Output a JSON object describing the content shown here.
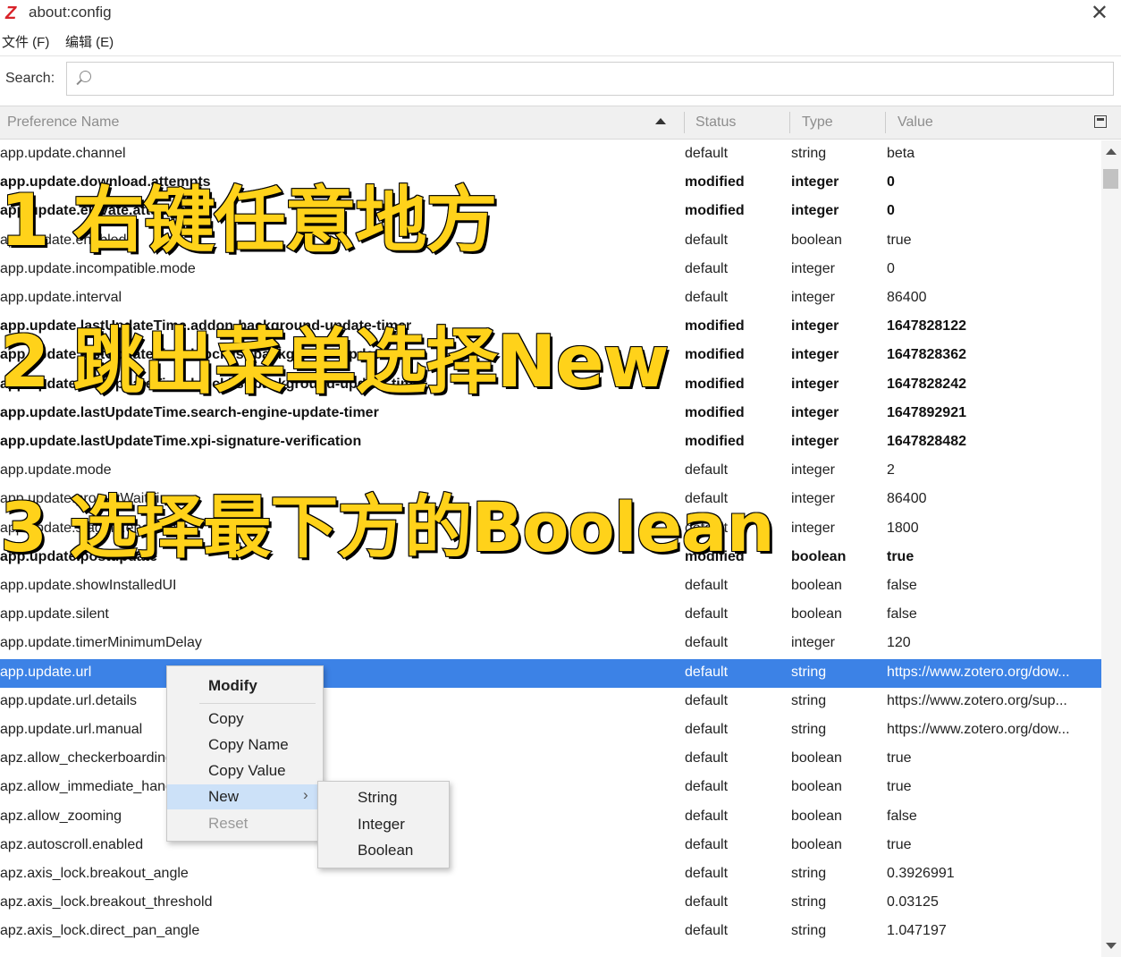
{
  "window": {
    "logo": "Z",
    "title": "about:config",
    "close_glyph": "✕"
  },
  "menubar": {
    "file": "文件 (F)",
    "edit": "编辑 (E)"
  },
  "search": {
    "label": "Search:",
    "value": ""
  },
  "columns": {
    "name": "Preference Name",
    "status": "Status",
    "type": "Type",
    "value": "Value"
  },
  "rows": [
    {
      "name": "app.update.channel",
      "status": "default",
      "type": "string",
      "value": "beta",
      "bold": false
    },
    {
      "name": "app.update.download.attempts",
      "status": "modified",
      "type": "integer",
      "value": "0",
      "bold": true
    },
    {
      "name": "app.update.elevate.attempts",
      "status": "modified",
      "type": "integer",
      "value": "0",
      "bold": true
    },
    {
      "name": "app.update.enabled",
      "status": "default",
      "type": "boolean",
      "value": "true",
      "bold": false
    },
    {
      "name": "app.update.incompatible.mode",
      "status": "default",
      "type": "integer",
      "value": "0",
      "bold": false
    },
    {
      "name": "app.update.interval",
      "status": "default",
      "type": "integer",
      "value": "86400",
      "bold": false
    },
    {
      "name": "app.update.lastUpdateTime.addon-background-update-timer",
      "status": "modified",
      "type": "integer",
      "value": "1647828122",
      "bold": true
    },
    {
      "name": "app.update.lastUpdateTime.blocklist-background-update-timer",
      "status": "modified",
      "type": "integer",
      "value": "1647828362",
      "bold": true
    },
    {
      "name": "app.update.lastUpdateTime.blocklist-background-update-timer",
      "status": "modified",
      "type": "integer",
      "value": "1647828242",
      "bold": true
    },
    {
      "name": "app.update.lastUpdateTime.search-engine-update-timer",
      "status": "modified",
      "type": "integer",
      "value": "1647892921",
      "bold": true
    },
    {
      "name": "app.update.lastUpdateTime.xpi-signature-verification",
      "status": "modified",
      "type": "integer",
      "value": "1647828482",
      "bold": true
    },
    {
      "name": "app.update.mode",
      "status": "default",
      "type": "integer",
      "value": "2",
      "bold": false
    },
    {
      "name": "app.update.promptWaitTime",
      "status": "default",
      "type": "integer",
      "value": "86400",
      "bold": false
    },
    {
      "name": "app.update.staging.enabled",
      "status": "default",
      "type": "integer",
      "value": "1800",
      "bold": false
    },
    {
      "name": "app.update.postupdate",
      "status": "modified",
      "type": "boolean",
      "value": "true",
      "bold": true
    },
    {
      "name": "app.update.showInstalledUI",
      "status": "default",
      "type": "boolean",
      "value": "false",
      "bold": false
    },
    {
      "name": "app.update.silent",
      "status": "default",
      "type": "boolean",
      "value": "false",
      "bold": false
    },
    {
      "name": "app.update.timerMinimumDelay",
      "status": "default",
      "type": "integer",
      "value": "120",
      "bold": false
    },
    {
      "name": "app.update.url",
      "status": "default",
      "type": "string",
      "value": "https://www.zotero.org/dow...",
      "bold": false,
      "selected": true
    },
    {
      "name": "app.update.url.details",
      "status": "default",
      "type": "string",
      "value": "https://www.zotero.org/sup...",
      "bold": false
    },
    {
      "name": "app.update.url.manual",
      "status": "default",
      "type": "string",
      "value": "https://www.zotero.org/dow...",
      "bold": false
    },
    {
      "name": "apz.allow_checkerboarding",
      "status": "default",
      "type": "boolean",
      "value": "true",
      "bold": false
    },
    {
      "name": "apz.allow_immediate_handoff",
      "status": "default",
      "type": "boolean",
      "value": "true",
      "bold": false
    },
    {
      "name": "apz.allow_zooming",
      "status": "default",
      "type": "boolean",
      "value": "false",
      "bold": false
    },
    {
      "name": "apz.autoscroll.enabled",
      "status": "default",
      "type": "boolean",
      "value": "true",
      "bold": false
    },
    {
      "name": "apz.axis_lock.breakout_angle",
      "status": "default",
      "type": "string",
      "value": "0.3926991",
      "bold": false
    },
    {
      "name": "apz.axis_lock.breakout_threshold",
      "status": "default",
      "type": "string",
      "value": "0.03125",
      "bold": false
    },
    {
      "name": "apz.axis_lock.direct_pan_angle",
      "status": "default",
      "type": "string",
      "value": "1.047197",
      "bold": false
    }
  ],
  "context_menu": {
    "modify": "Modify",
    "copy": "Copy",
    "copy_name": "Copy Name",
    "copy_value": "Copy Value",
    "new": "New",
    "reset": "Reset",
    "submenu_arrow": "›"
  },
  "submenu": {
    "string": "String",
    "integer": "Integer",
    "boolean": "Boolean"
  },
  "overlay": {
    "step1": "1 右键任意地方",
    "step2": "2 跳出菜单选择New",
    "step3": "3 选择最下方的Boolean"
  },
  "colors": {
    "selection": "#3c82e6",
    "overlay_text": "#ffd21a",
    "logo": "#d8232a"
  }
}
